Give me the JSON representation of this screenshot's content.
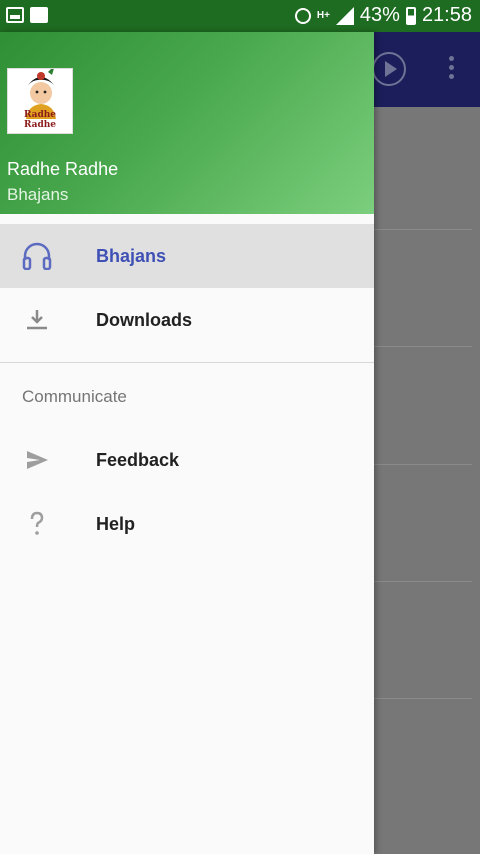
{
  "status_bar": {
    "battery": "43%",
    "time": "21:58",
    "network": "H+"
  },
  "drawer": {
    "avatar_caption": "Radhe Radhe",
    "app_name": "Radhe Radhe",
    "app_subtitle": "Bhajans",
    "items": [
      {
        "label": "Bhajans",
        "icon": "headphones-icon",
        "active": true
      },
      {
        "label": "Downloads",
        "icon": "download-icon",
        "active": false
      }
    ],
    "section_title": "Communicate",
    "communicate_items": [
      {
        "label": "Feedback",
        "icon": "send-icon"
      },
      {
        "label": "Help",
        "icon": "help-icon"
      }
    ]
  },
  "colors": {
    "accent": "#3f51b5",
    "header_green": "#2f8f35",
    "status_bar": "#1e6c21"
  }
}
